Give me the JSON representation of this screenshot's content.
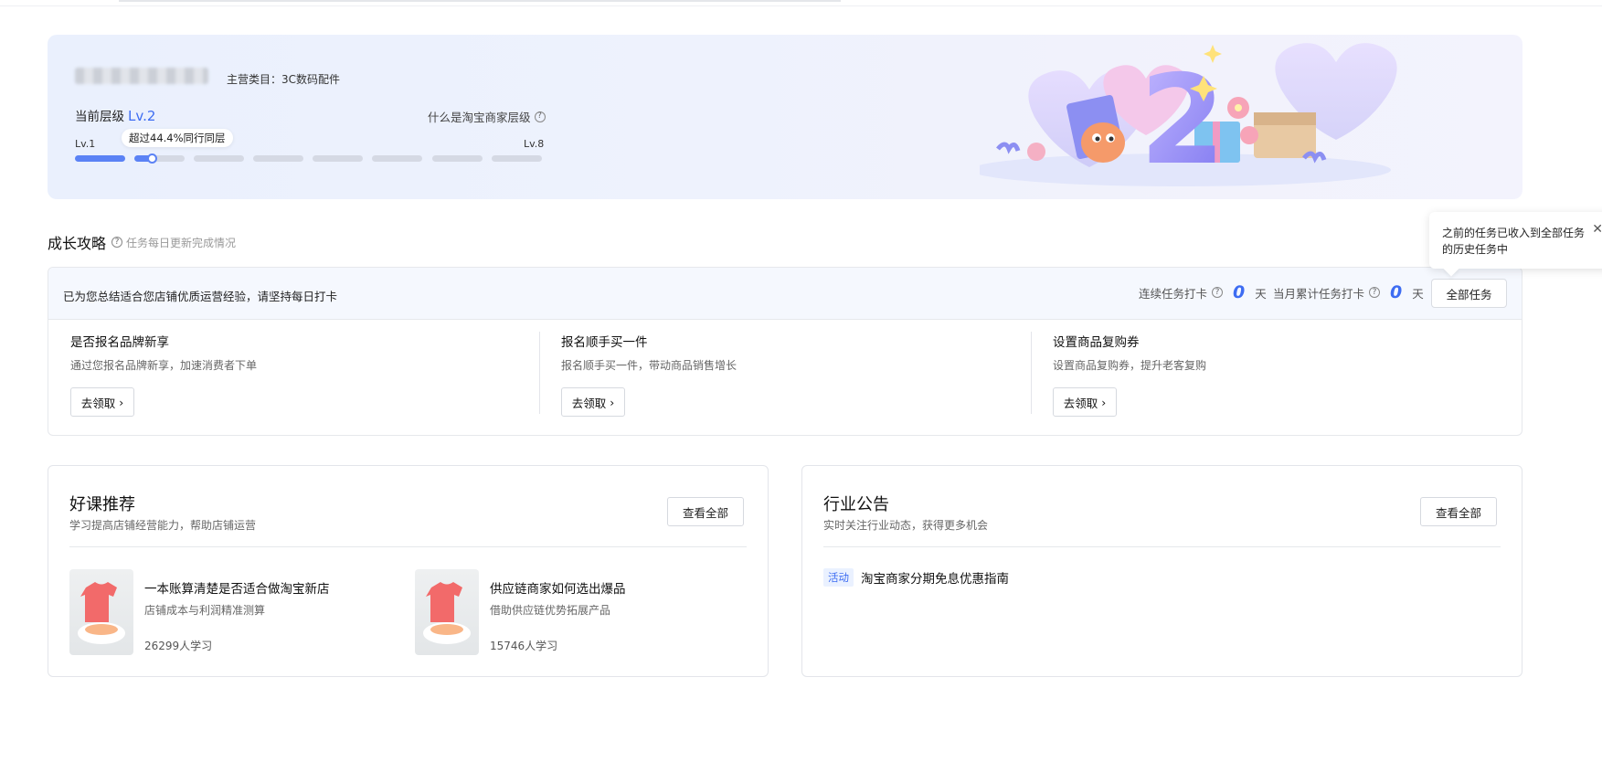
{
  "banner": {
    "category": "主营类目：3C数码配件",
    "current_level_label": "当前层级",
    "current_level_value": "Lv.2",
    "what_is_level": "什么是淘宝商家层级",
    "lv_start": "Lv.1",
    "lv_end": "Lv.8",
    "percentile_tip": "超过44.4%同行同层",
    "progress_segments": 8,
    "current_segment_progress": 0.42,
    "illustration_number": "2"
  },
  "growth": {
    "title": "成长攻略",
    "subtitle": "任务每日更新完成情况",
    "popover_text": "之前的任务已收入到全部任务的历史任务中",
    "message": "已为您总结适合您店铺优质运营经验，请坚持每日打卡",
    "streak_label": "连续任务打卡",
    "streak_value": "0",
    "streak_unit": "天",
    "monthly_label": "当月累计任务打卡",
    "monthly_value": "0",
    "monthly_unit": "天",
    "all_tasks_label": "全部任务",
    "tasks": [
      {
        "title": "是否报名品牌新享",
        "desc": "通过您报名品牌新享，加速消费者下单",
        "button": "去领取"
      },
      {
        "title": "报名顺手买一件",
        "desc": "报名顺手买一件，带动商品销售增长",
        "button": "去领取"
      },
      {
        "title": "设置商品复购券",
        "desc": "设置商品复购券，提升老客复购",
        "button": "去领取"
      }
    ]
  },
  "courses": {
    "title": "好课推荐",
    "subtitle": "学习提高店铺经营能力，帮助店铺运营",
    "view_all": "查看全部",
    "items": [
      {
        "title": "一本账算清楚是否适合做淘宝新店",
        "desc": "店铺成本与利润精准测算",
        "students": "26299人学习"
      },
      {
        "title": "供应链商家如何选出爆品",
        "desc": "借助供应链优势拓展产品",
        "students": "15746人学习"
      }
    ]
  },
  "notices": {
    "title": "行业公告",
    "subtitle": "实时关注行业动态，获得更多机会",
    "view_all": "查看全部",
    "items": [
      {
        "tag": "活动",
        "title": "淘宝商家分期免息优惠指南"
      }
    ]
  },
  "colors": {
    "accent": "#3d6cf2",
    "progress_done": "#5b82f5",
    "progress_todo": "#d5d9e4"
  }
}
